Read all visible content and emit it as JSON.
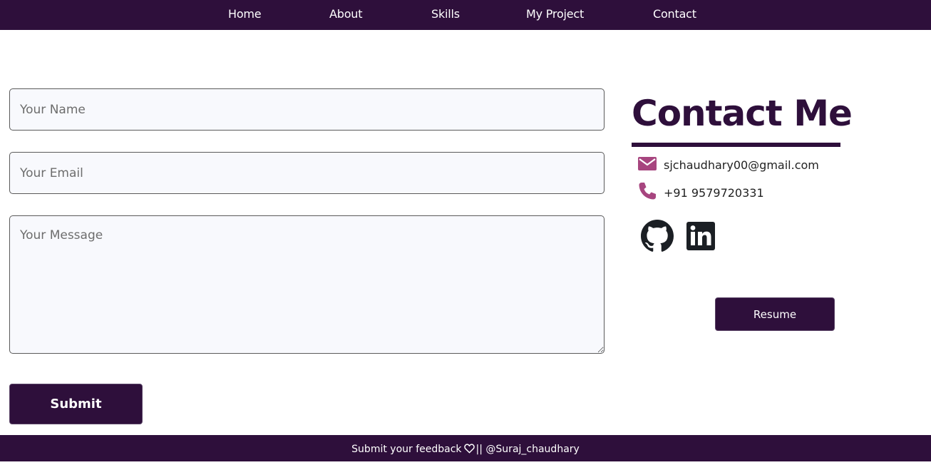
{
  "nav": {
    "items": [
      "Home",
      "About",
      "Skills",
      "My Project",
      "Contact"
    ]
  },
  "form": {
    "name_placeholder": "Your Name",
    "email_placeholder": "Your Email",
    "message_placeholder": "Your Message",
    "submit_label": "Submit"
  },
  "contact": {
    "title": "Contact Me",
    "email": "sjchaudhary00@gmail.com",
    "phone": "+91 9579720331",
    "resume_label": "Resume",
    "email_icon": "envelope-icon",
    "phone_icon": "phone-icon",
    "social_icons": [
      "github-icon",
      "linkedin-icon"
    ]
  },
  "footer": {
    "feedback_text": "Submit your feedback",
    "separator": "||",
    "handle": "@Suraj_chaudhary"
  },
  "colors": {
    "brand": "#2e0f3b",
    "icon_accent": "#a7457f",
    "field_bg": "#f8f9fd"
  }
}
